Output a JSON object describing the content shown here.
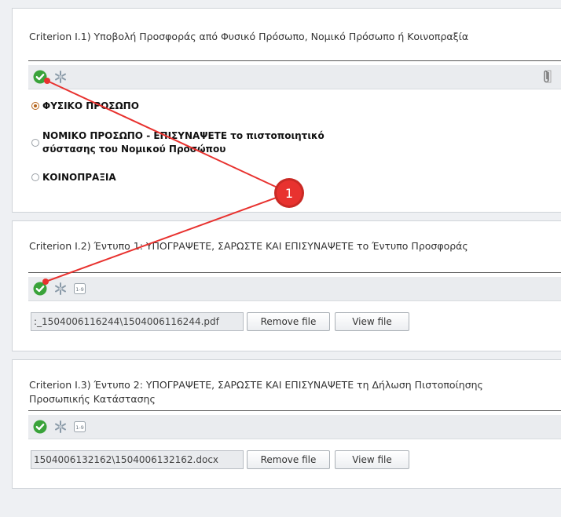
{
  "criteria": [
    {
      "title": "Criterion I.1) Υποβολή Προσφοράς από Φυσικό Πρόσωπο, Νομικό Πρόσωπο ή Κοινοπραξία",
      "options": [
        {
          "label": "ΦΥΣΙΚΟ ΠΡΟΣΩΠΟ",
          "selected": true
        },
        {
          "label": "ΝΟΜΙΚΟ ΠΡΟΣΩΠΟ - ΕΠΙΣΥΝΑΨΕΤΕ το πιστοποιητικό σύστασης του Νομικού Προσώπου",
          "selected": false
        },
        {
          "label": "ΚΟΙΝΟΠΡΑΞΙΑ",
          "selected": false
        }
      ]
    },
    {
      "title": "Criterion I.2) Έντυπο 1: ΥΠΟΓΡΑΨΕΤΕ, ΣΑΡΩΣΤΕ ΚΑΙ ΕΠΙΣΥΝΑΨΕΤΕ το Έντυπο Προσφοράς",
      "file_value": ":_1504006116244\\1504006116244.pdf",
      "remove_label": "Remove file",
      "view_label": "View file"
    },
    {
      "title": "Criterion I.3) Έντυπο 2: ΥΠΟΓΡΑΨΕΤΕ, ΣΑΡΩΣΤΕ ΚΑΙ ΕΠΙΣΥΝΑΨΕΤΕ τη Δήλωση Πιστοποίησης Προσωπικής Κατάστασης",
      "file_value": "1504006132162\\1504006132162.docx",
      "remove_label": "Remove file",
      "view_label": "View file"
    }
  ],
  "annotation": {
    "number": "1",
    "color": "#e8322f"
  },
  "colors": {
    "ok_green": "#3aa33a",
    "snow_gray": "#8a9aa8",
    "accent_orange": "#b5651d"
  },
  "icons": [
    "check-circle-icon",
    "snowflake-icon",
    "paperclip-icon",
    "numbered-list-icon"
  ]
}
